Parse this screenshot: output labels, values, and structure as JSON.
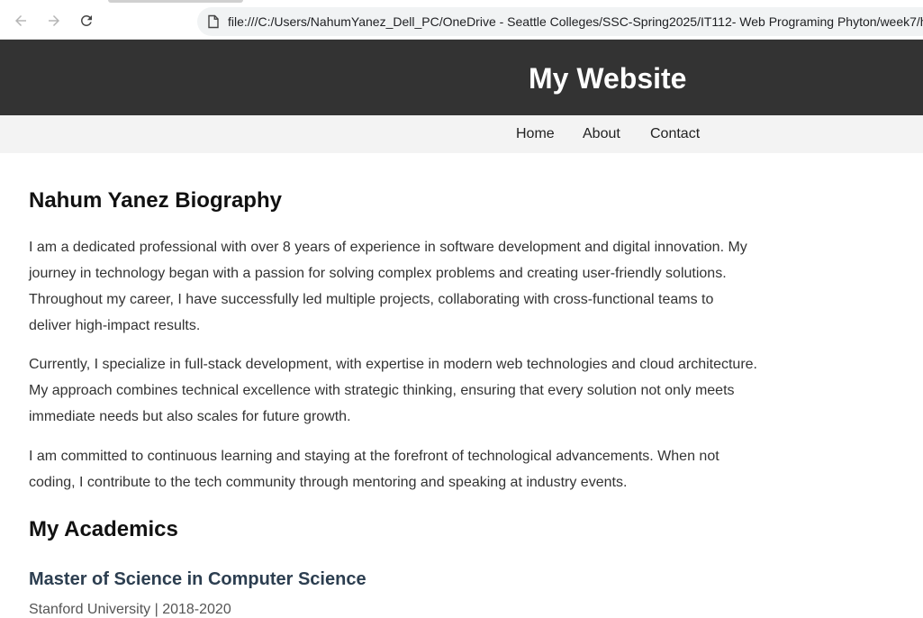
{
  "browser": {
    "url": "file:///C:/Users/NahumYanez_Dell_PC/OneDrive - Seattle Colleges/SSC-Spring2025/IT112- Web Programing Phyton/week7/h",
    "icons": {
      "back": "arrow-left-icon",
      "forward": "arrow-right-icon",
      "reload": "reload-icon",
      "page": "file-icon"
    }
  },
  "header": {
    "title": "My Website"
  },
  "nav": {
    "home": "Home",
    "about": "About",
    "contact": "Contact"
  },
  "main": {
    "bio_heading": "Nahum Yanez Biography",
    "paragraphs": [
      "I am a dedicated professional with over 8 years of experience in software development and digital innovation. My journey in technology began with a passion for solving complex problems and creating user-friendly solutions. Throughout my career, I have successfully led multiple projects, collaborating with cross-functional teams to deliver high-impact results.",
      "Currently, I specialize in full-stack development, with expertise in modern web technologies and cloud architecture. My approach combines technical excellence with strategic thinking, ensuring that every solution not only meets immediate needs but also scales for future growth.",
      "I am committed to continuous learning and staying at the forefront of technological advancements. When not coding, I contribute to the tech community through mentoring and speaking at industry events."
    ],
    "academics_heading": "My Academics",
    "degree": {
      "title": "Master of Science in Computer Science",
      "meta": "Stanford University | 2018-2020"
    }
  },
  "colors": {
    "header_bg": "#333333",
    "nav_bg": "#f3f3f3",
    "degree_title": "#2c3e50"
  }
}
